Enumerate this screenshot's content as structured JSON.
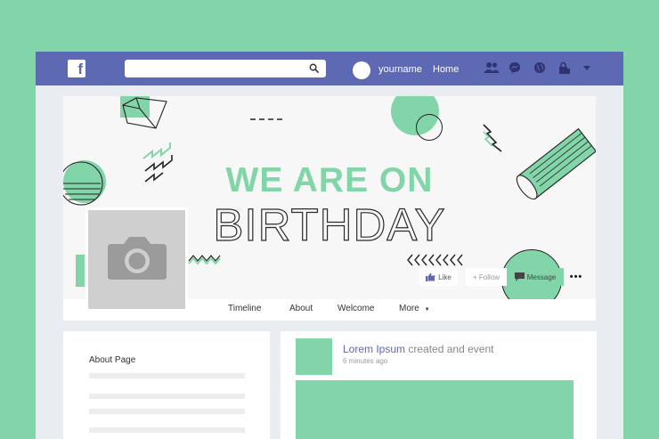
{
  "colors": {
    "background": "#82d5a8",
    "topbar": "#5e69b3",
    "accent": "#82d5a8",
    "page": "#e9edf2"
  },
  "topbar": {
    "logo_letter": "f",
    "search": {
      "value": "",
      "placeholder": ""
    },
    "username": "yourname",
    "home_label": "Home",
    "icons": [
      "friends-icon",
      "messenger-icon",
      "globe-icon",
      "lock-icon",
      "dropdown-caret-icon"
    ]
  },
  "cover": {
    "line1": "WE ARE ON",
    "line2": "BIRTHDAY",
    "buttons": {
      "like": "Like",
      "follow": "+ Follow",
      "message": "Message",
      "more": "•••"
    }
  },
  "tabs": [
    {
      "label": "Timeline"
    },
    {
      "label": "About"
    },
    {
      "label": "Welcome"
    },
    {
      "label": "More"
    }
  ],
  "about": {
    "title": "About Page"
  },
  "post": {
    "author": "Lorem Ipsum",
    "action": "created and event",
    "time": "6 minutes ago"
  }
}
